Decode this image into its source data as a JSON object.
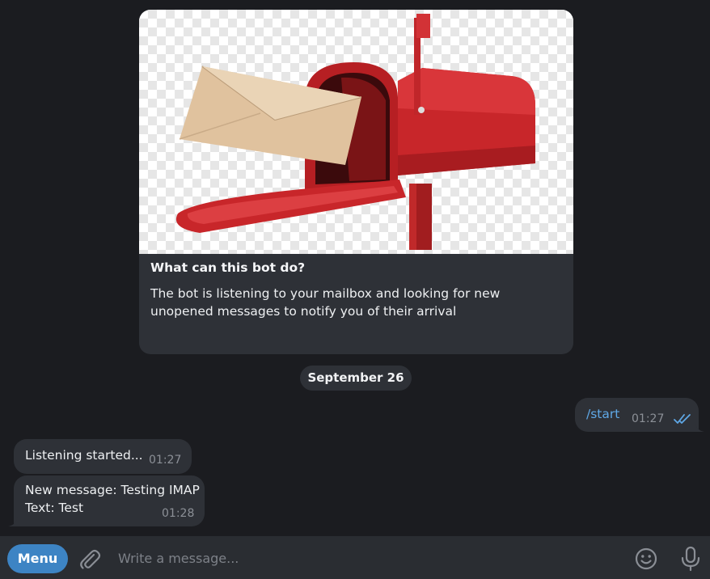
{
  "intro": {
    "title": "What can this bot do?",
    "description": "The bot is listening to your mailbox and looking for new unopened messages to notify you of their arrival",
    "image": "mailbox-with-envelope"
  },
  "date_separator": "September 26",
  "messages": [
    {
      "direction": "outgoing",
      "text": "/start",
      "time": "01:27",
      "status_icon": "double-check-icon"
    },
    {
      "direction": "incoming",
      "text": "Listening started...",
      "time": "01:27"
    },
    {
      "direction": "incoming",
      "line1": "New message: Testing IMAP",
      "line2": "Text: Test",
      "time": "01:28"
    }
  ],
  "composer": {
    "menu_label": "Menu",
    "placeholder": "Write a message...",
    "icons": [
      "paperclip-icon",
      "emoji-icon",
      "microphone-icon"
    ]
  },
  "colors": {
    "background": "#1b1c20",
    "bubble": "#2e3137",
    "accent": "#3d84c4",
    "link": "#5fa8e6",
    "timestamp": "#8c9097"
  }
}
